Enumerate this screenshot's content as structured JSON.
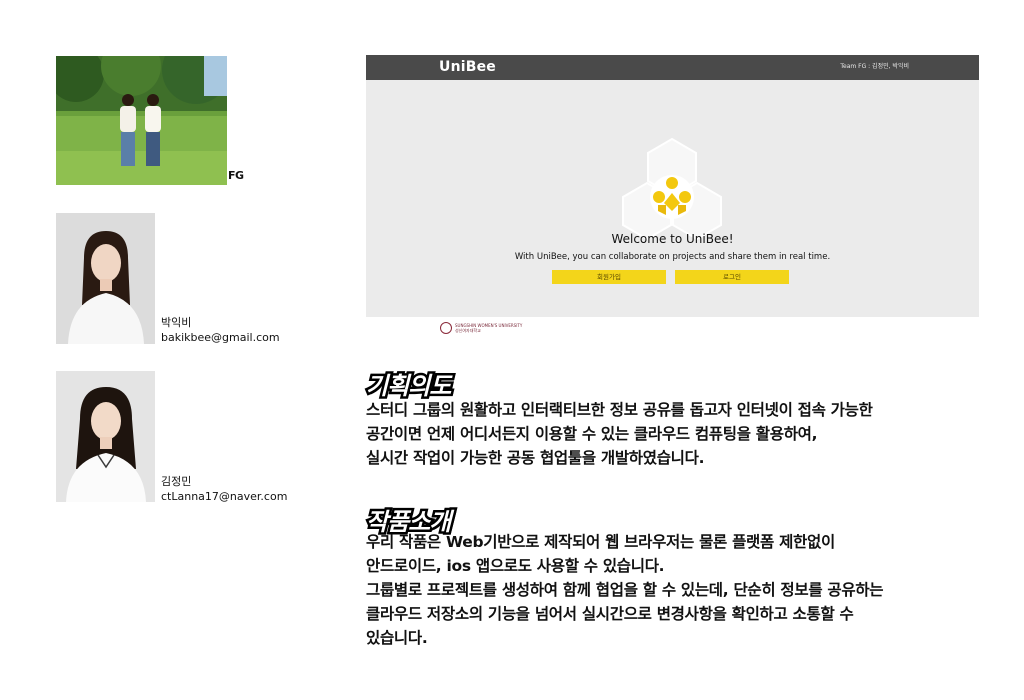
{
  "team": {
    "label": "FG"
  },
  "members": [
    {
      "name": "박익비",
      "email": "bakikbee@gmail.com"
    },
    {
      "name": "김정민",
      "email": "ctLanna17@naver.com"
    }
  ],
  "app_screenshot": {
    "logo": "UniBee",
    "team_text": "Team FG : 김정민, 박익비",
    "welcome": "Welcome to UniBee!",
    "description": "With UniBee, you can collaborate on projects and share them in real time.",
    "signup_label": "회원가입",
    "login_label": "로그인",
    "university_name_en": "SUNGSHIN WOMEN'S UNIVERSITY",
    "university_name_kr": "성신여자대학교",
    "colors": {
      "bar": "#4a4a4a",
      "button": "#f3d51a",
      "background": "#ebebeb"
    }
  },
  "plan": {
    "title": "기획의도",
    "lines": [
      "스터디 그룹의 원활하고 인터랙티브한 정보 공유를 돕고자 인터넷이 접속 가능한",
      "공간이면 언제 어디서든지 이용할 수 있는 클라우드 컴퓨팅을 활용하여,",
      "실시간 작업이 가능한 공동 협업툴을 개발하였습니다."
    ]
  },
  "intro": {
    "title": "작품소개",
    "lines": [
      "우리 작품은 Web기반으로 제작되어 웹 브라우저는 물론 플랫폼 제한없이",
      "안드로이드, ios 앱으로도 사용할 수 있습니다.",
      "그룹별로 프로젝트를 생성하여 함께 협업을 할 수 있는데, 단순히 정보를 공유하는",
      "클라우드 저장소의 기능을 넘어서 실시간으로 변경사항을 확인하고 소통할 수",
      "있습니다."
    ]
  }
}
